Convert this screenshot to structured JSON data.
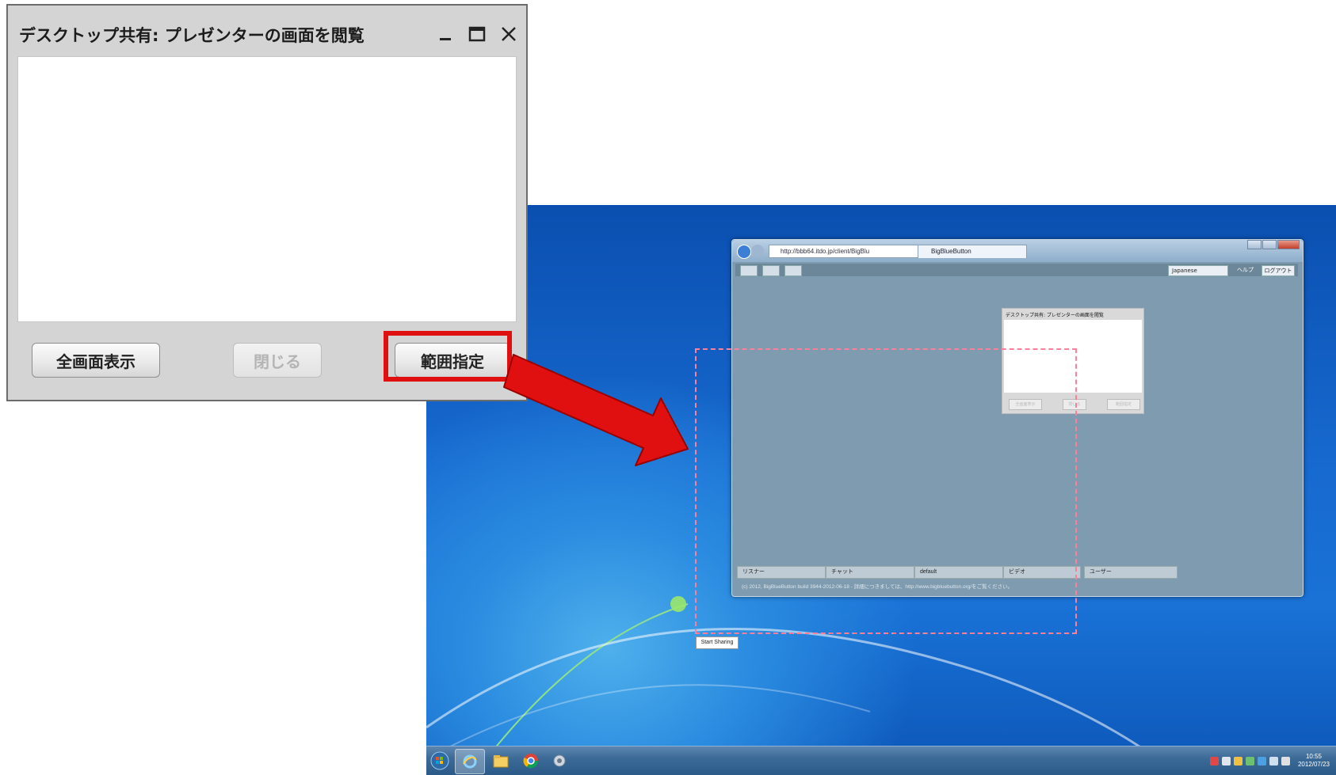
{
  "dialog": {
    "title": "デスクトップ共有: プレゼンターの画面を閲覧",
    "buttons": {
      "fullscreen": "全画面表示",
      "close": "閉じる",
      "region": "範囲指定"
    },
    "close_disabled": true,
    "highlighted_button": "region"
  },
  "browser": {
    "address": "http://bbb64.itdo.jp/client/BigBlu",
    "tab_title": "BigBlueButton",
    "language_select": "Japanese",
    "help_link": "ヘルプ",
    "logout_button": "ログアウト",
    "mini_dialog_title": "デスクトップ共有: プレゼンターの画面を閲覧",
    "panels": [
      "リスナー",
      "チャット",
      "default",
      "ビデオ",
      "ユーザー"
    ],
    "footer": "(c) 2012, BigBlueButton build 3944-2012-06-18 - 詳細につきましては、http://www.bigbluebutton.org/をご覧ください。"
  },
  "desktop": {
    "start_sharing": "Start Sharing",
    "clock_time": "10:55",
    "clock_date": "2012/07/23"
  },
  "colors": {
    "highlight": "#e01010",
    "arrow": "#e01010",
    "selection": "#ff7f9a"
  },
  "icons": [
    "minimize-icon",
    "maximize-icon",
    "close-icon",
    "windows-start-icon",
    "ie-icon",
    "explorer-icon",
    "chrome-icon",
    "app-icon"
  ]
}
